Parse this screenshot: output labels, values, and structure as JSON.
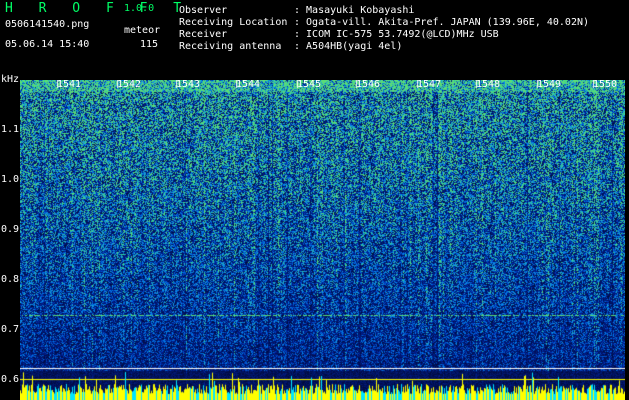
{
  "header": {
    "app_title": "H R O F F T",
    "version": "1.0.0",
    "filename": "0506141540.png",
    "datetime": "05.06.14 15:40",
    "mode_label": "meteor",
    "count": "115",
    "info": [
      {
        "label": "Observer",
        "value": ": Masayuki Kobayashi"
      },
      {
        "label": "Receiving Location",
        "value": ": Ogata-vill. Akita-Pref. JAPAN (139.96E, 40.02N)"
      },
      {
        "label": "Receiver",
        "value": ": ICOM IC-575 53.7492(@LCD)MHz USB"
      },
      {
        "label": "Receiving antenna",
        "value": ": A504HB(yagi 4el)"
      }
    ]
  },
  "spectrogram": {
    "y_unit": "kHz",
    "y_ticks": [
      "1.1",
      "1.0",
      "0.9",
      "0.8",
      "0.7",
      "0.6"
    ],
    "minute_markers": [
      "1541",
      "1542",
      "1543",
      "1544",
      "1545",
      "1546",
      "1547",
      "1548",
      "1549",
      "1550"
    ],
    "colors": {
      "background": "#000000",
      "low": "#001a8c",
      "mid": "#1e6fff",
      "high": "#33cc66",
      "text": "#ffffff",
      "header_accent": "#00ff66",
      "bottom_bar": "#ffff00",
      "bottom_bar_alt": "#00e5ff"
    }
  }
}
